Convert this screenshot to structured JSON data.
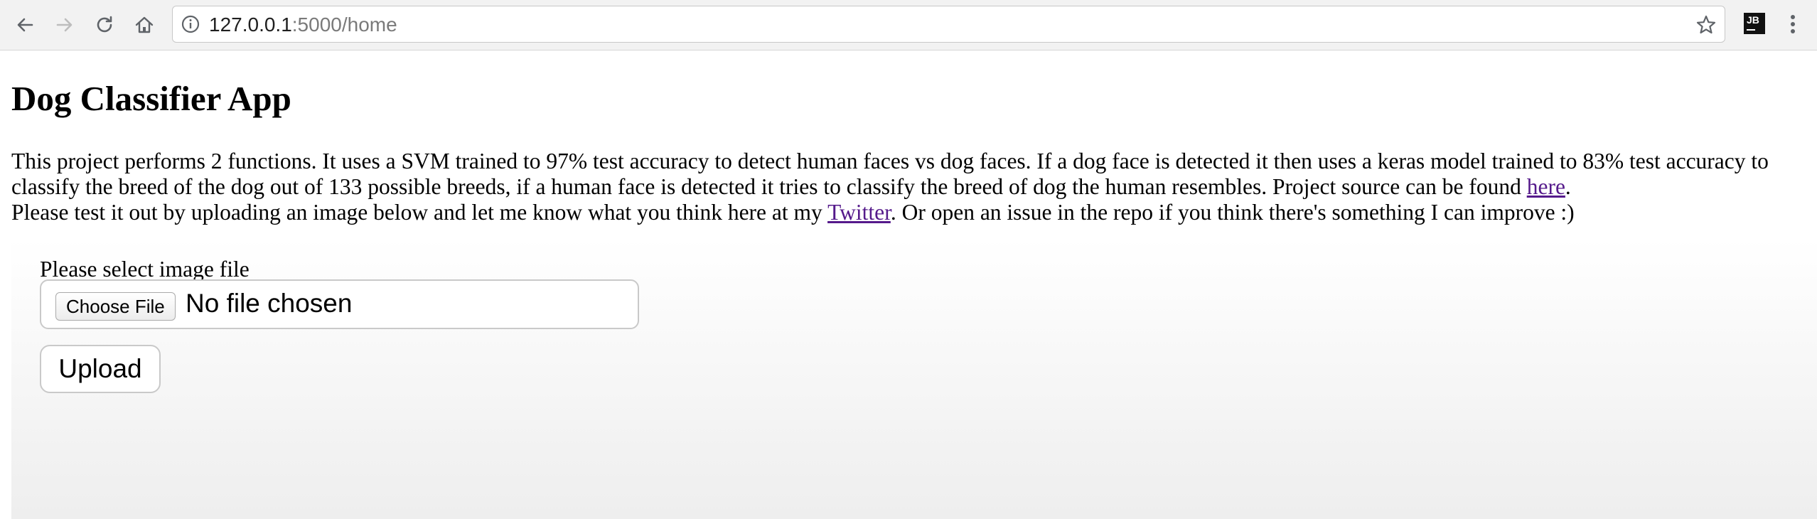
{
  "browser": {
    "url_host": "127.0.0.1",
    "url_rest": ":5000/home",
    "extension_badge": "JB"
  },
  "page": {
    "title": "Dog Classifier App",
    "intro_part1": "This project performs 2 functions. It uses a SVM trained to 97% test accuracy to detect human faces vs dog faces. If a dog face is detected it then uses a keras model trained to 83% test accuracy to classify the breed of the dog out of 133 possible breeds, if a human face is detected it tries to classify the breed of dog the human resembles. Project source can be found ",
    "source_link": "here",
    "intro_part2": ".",
    "intro_part3": "Please test it out by uploading an image below and let me know what you think here at my ",
    "twitter_link": "Twitter",
    "intro_part4": ". Or open an issue in the repo if you think there's something I can improve :)"
  },
  "form": {
    "file_label": "Please select image file",
    "choose_button": "Choose File",
    "no_file_text": "No file chosen",
    "upload_button": "Upload"
  },
  "colors": {
    "visited_link": "#551a8b",
    "toolbar_bg": "#f2f2f2"
  },
  "icons": [
    "back-icon",
    "forward-icon",
    "reload-icon",
    "home-icon",
    "info-icon",
    "star-icon",
    "jetbrains-extension-icon",
    "menu-kebab-icon"
  ]
}
